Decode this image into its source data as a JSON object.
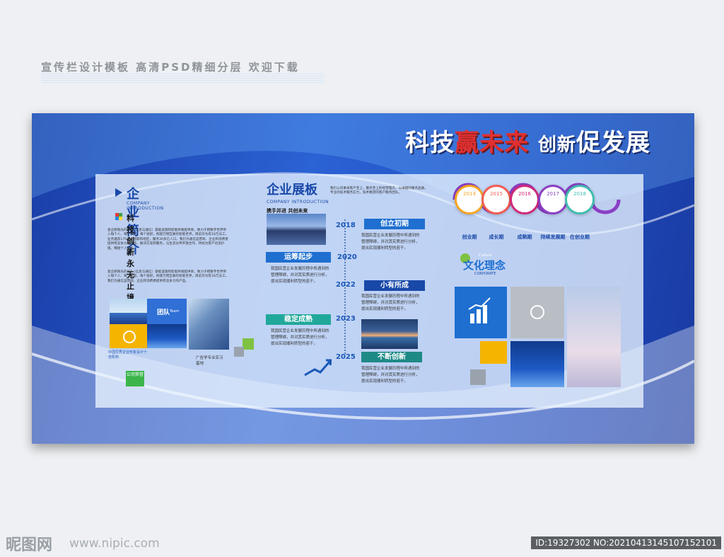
{
  "header": {
    "caption": "宣传栏设计模板 高清PSD精细分层 欢迎下载"
  },
  "slogan": {
    "part1": "科技",
    "part2": "赢未来",
    "part3": "创新",
    "part4": "促发展"
  },
  "intro": {
    "title": "企业简介",
    "subtitle": "COMPANY INTRODUCTION",
    "tagline": "科技创新 永无止境",
    "body": "星企研限光的ICT（信息与通信）基础设施和智能终端提供商，致力于把数字世界带入每个人、每个家庭、每个组织，构建万物互联的智能世界。目前华为有18万员工，业务遍及170多个国家和地区，服务30多亿人口。我们为通信运营商、企业和消费者提供有竞争力的产品、解决方案和服务，与生态伙伴开放合作，持续为客户创造价值，释放个人潜能。",
    "body2": "星企研限光的ICT（信息与通信）基础设施和智能终端提供商，致力于把数字世界带入每个人、每个家庭、每个组织，构建万物互联的智能世界。目前华为有18万员工，我们为通信运营商、企业和消费者提供有竞争力的产品。",
    "team_label": "团队",
    "team_sub": "Team",
    "honor_text": "中国优秀企业形象设计十佳机构",
    "honor_badge": "公司荣誉",
    "edu_text": "广告学专业实习基地"
  },
  "exhibit": {
    "title": "企业展板",
    "subtitle": "COMPANY INTRODUCTION",
    "tagline": "携手并进 共创未来",
    "intro": "我们公司秉承客户至上，服务至上的经营理念，以卓越的服务品质，专业的技术服务实力，技术精湛的客户服务团队。",
    "milestone_text": "我国民营企业发展历程中所遇到的管理障碍，并对其实质进行分析，提出实现顺利转型的若干。",
    "milestones": [
      {
        "year": "2018",
        "label": "创立初期"
      },
      {
        "year": "2020",
        "label": "运筹起步"
      },
      {
        "year": "2022",
        "label": "小有所成"
      },
      {
        "year": "2023",
        "label": "稳定成熟"
      },
      {
        "year": "2025",
        "label": "不断创新"
      }
    ]
  },
  "timeline": {
    "nodes": [
      {
        "year": "2014",
        "label": "创业期",
        "color": "#f5a623"
      },
      {
        "year": "2015",
        "label": "成长期",
        "color": "#f25c54"
      },
      {
        "year": "2016",
        "label": "成熟期",
        "color": "#d0297a"
      },
      {
        "year": "2017",
        "label": "持续发展期",
        "color": "#8b3fc4"
      },
      {
        "year": "2018",
        "label": "在创业期",
        "color": "#3fbfb0"
      }
    ]
  },
  "culture": {
    "title": "文化理念",
    "small_en": "Culture",
    "corporate": "CORPORATE"
  },
  "footer": {
    "logo": "昵图网",
    "url": "www.nipic.com",
    "id": "ID:19327302 NO:20210413145107152101"
  }
}
